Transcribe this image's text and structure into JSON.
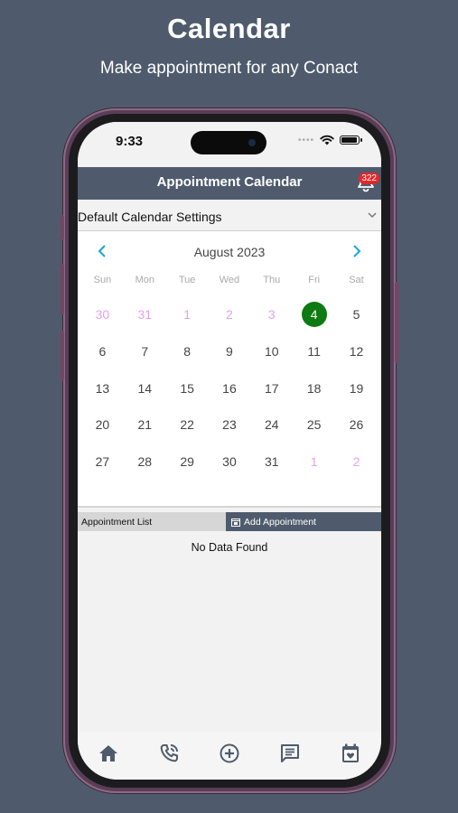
{
  "promo": {
    "title": "Calendar",
    "subtitle": "Make appointment for any Conact"
  },
  "status_bar": {
    "time": "9:33",
    "icons": [
      "cellular-dots-icon",
      "wifi-icon",
      "battery-icon"
    ]
  },
  "header": {
    "title": "Appointment Calendar",
    "notification_count": "322",
    "color": "#4f5b6d"
  },
  "settings": {
    "selected": "Default Calendar Settings"
  },
  "calendar": {
    "month_label": "August 2023",
    "weekdays": [
      "Sun",
      "Mon",
      "Tue",
      "Wed",
      "Thu",
      "Fri",
      "Sat"
    ],
    "selected_day": "4",
    "selected_color": "#0e7a12",
    "other_month_color": "#e3a1ec",
    "weeks": [
      [
        "30",
        "31",
        "1",
        "2",
        "3",
        "4",
        "5"
      ],
      [
        "6",
        "7",
        "8",
        "9",
        "10",
        "11",
        "12"
      ],
      [
        "13",
        "14",
        "15",
        "16",
        "17",
        "18",
        "19"
      ],
      [
        "20",
        "21",
        "22",
        "23",
        "24",
        "25",
        "26"
      ],
      [
        "27",
        "28",
        "29",
        "30",
        "31",
        "1",
        "2"
      ]
    ]
  },
  "tabs": {
    "list_label": "Appointment List",
    "add_label": "Add Appointment"
  },
  "list": {
    "empty_message": "No Data Found"
  },
  "bottom_nav": [
    "home-icon",
    "phone-call-icon",
    "add-circle-icon",
    "message-icon",
    "calendar-heart-icon"
  ]
}
